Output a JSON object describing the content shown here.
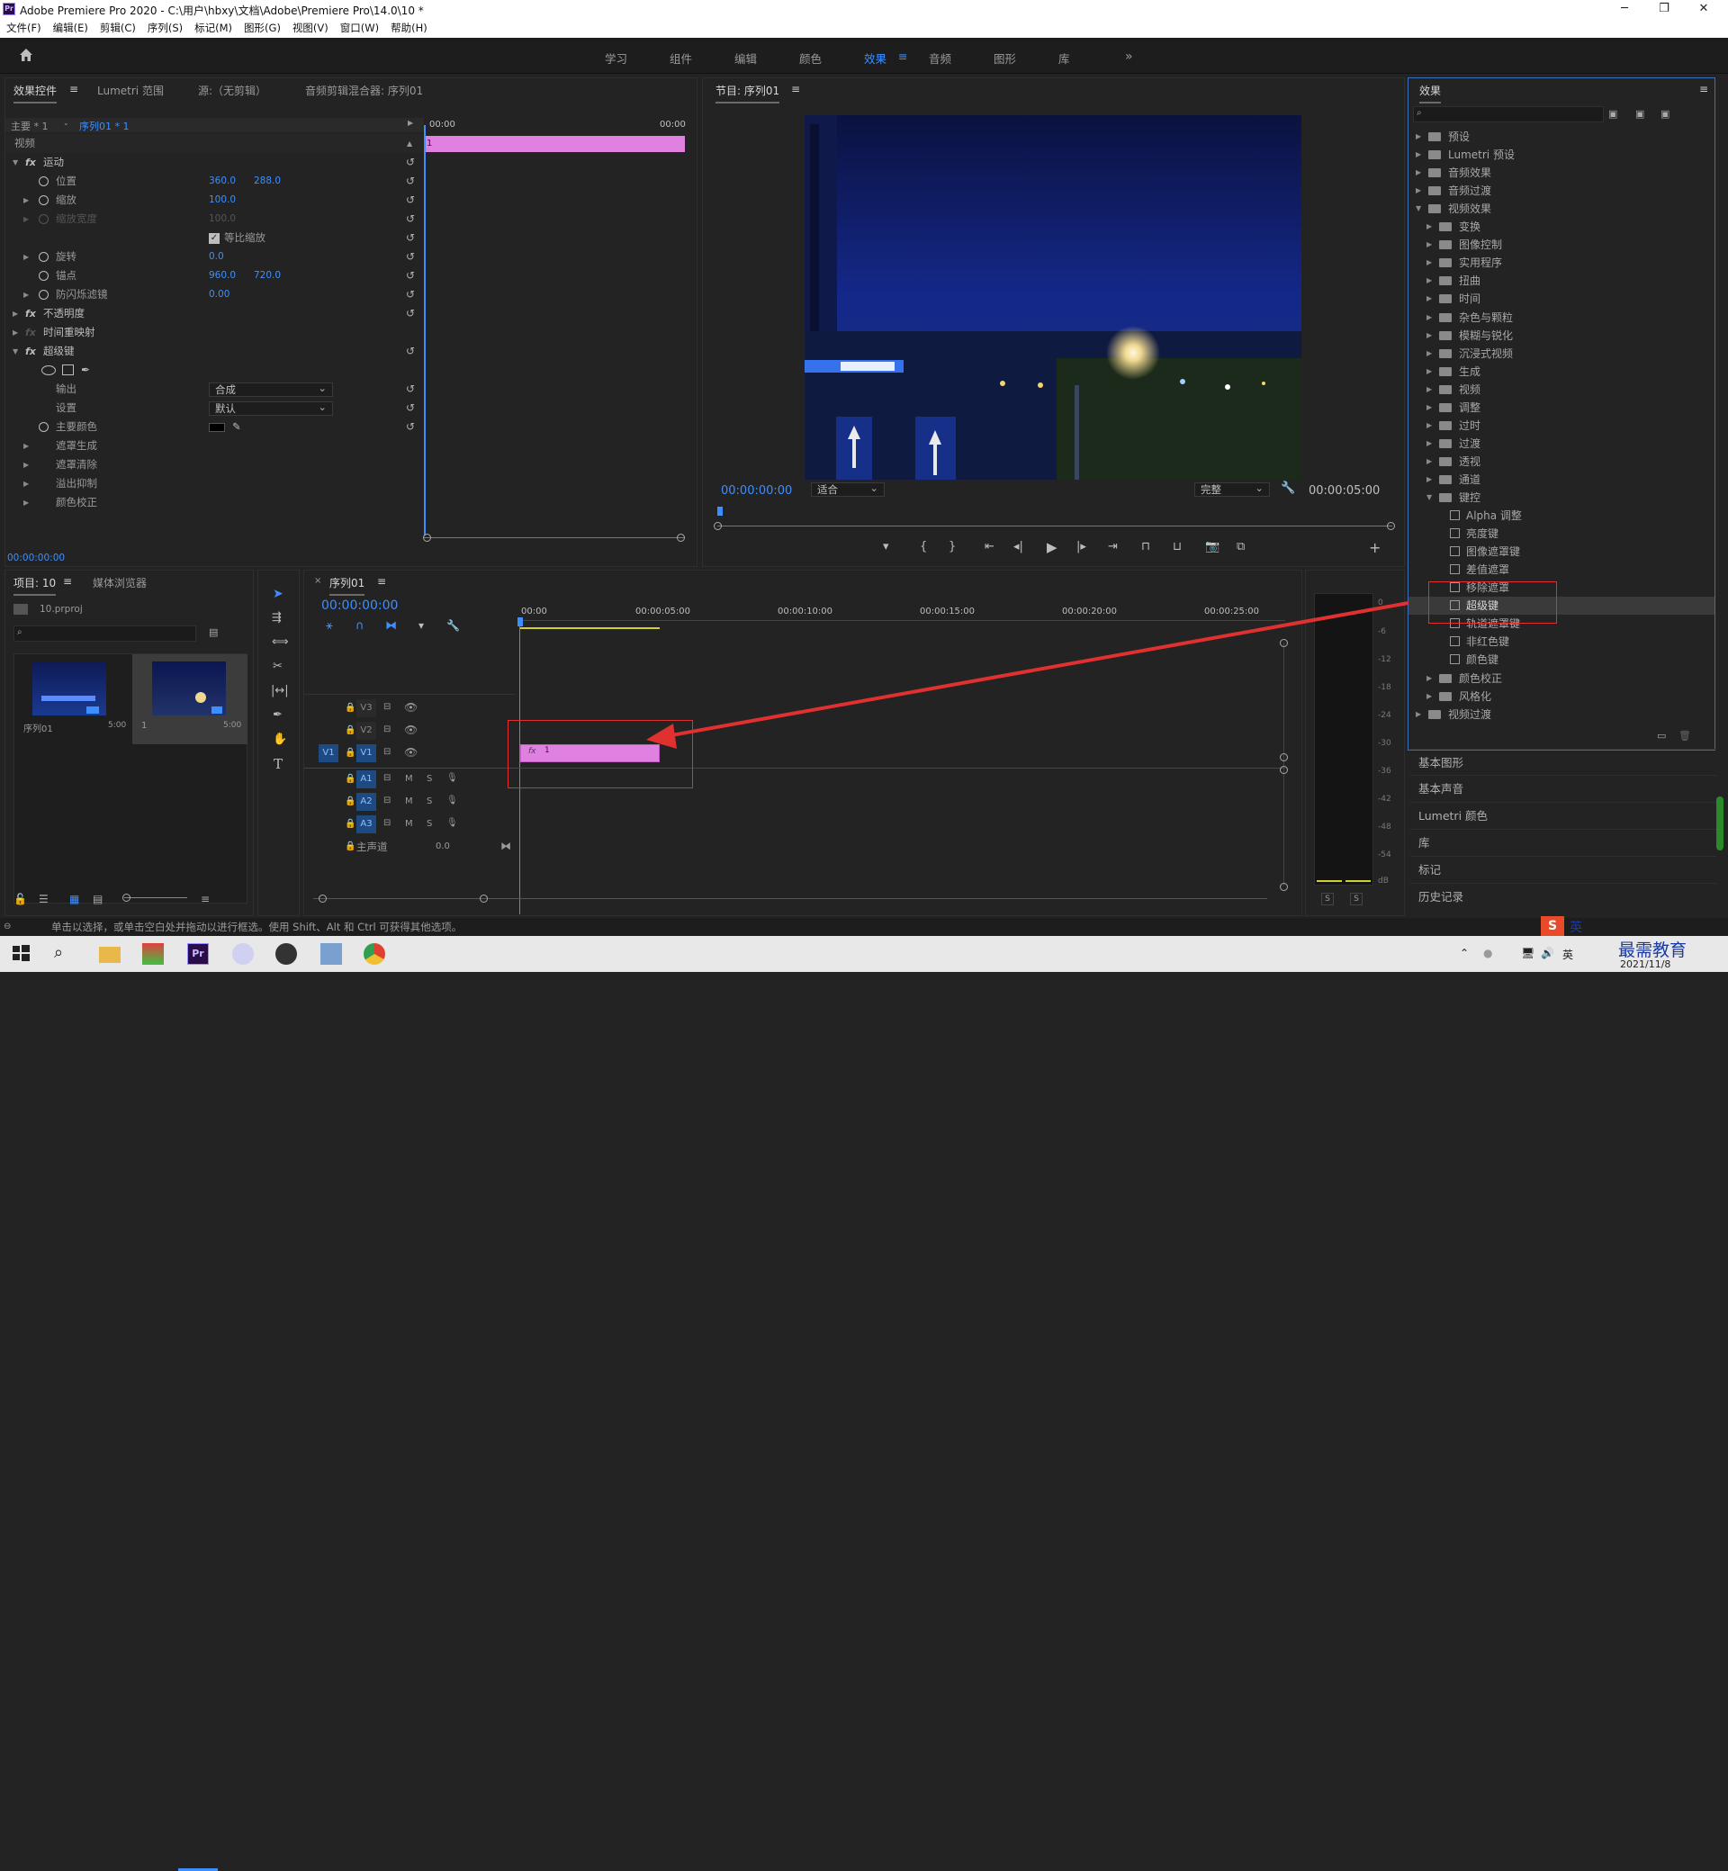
{
  "window": {
    "title": "Adobe Premiere Pro 2020 - C:\\用户\\hbxy\\文档\\Adobe\\Premiere Pro\\14.0\\10 *",
    "app_icon": "Pr"
  },
  "menu": [
    "文件(F)",
    "编辑(E)",
    "剪辑(C)",
    "序列(S)",
    "标记(M)",
    "图形(G)",
    "视图(V)",
    "窗口(W)",
    "帮助(H)"
  ],
  "workspaces": [
    {
      "label": "学习"
    },
    {
      "label": "组件"
    },
    {
      "label": "编辑"
    },
    {
      "label": "颜色"
    },
    {
      "label": "效果",
      "active": true
    },
    {
      "label": "音频"
    },
    {
      "label": "图形"
    },
    {
      "label": "库"
    }
  ],
  "effect_controls": {
    "tabs": [
      "效果控件",
      "Lumetri 范围",
      "源:（无剪辑）",
      "音频剪辑混合器: 序列01"
    ],
    "master": "主要 * 1",
    "sequence": "序列01 * 1",
    "timecode_start": "00:00",
    "timecode_end": "00:00",
    "clip_label": "1",
    "section_video": "视频",
    "motion": "运动",
    "position_label": "位置",
    "position_x": "360.0",
    "position_y": "288.0",
    "scale_label": "缩放",
    "scale_value": "100.0",
    "scale_width_label": "缩放宽度",
    "scale_width_value": "100.0",
    "uniform_scale_label": "等比缩放",
    "rotation_label": "旋转",
    "rotation_value": "0.0",
    "anchor_label": "锚点",
    "anchor_x": "960.0",
    "anchor_y": "720.0",
    "flicker_label": "防闪烁滤镜",
    "flicker_value": "0.00",
    "opacity": "不透明度",
    "time_remap": "时间重映射",
    "ultra_key": "超级键",
    "output_label": "输出",
    "output_value": "合成",
    "setting_label": "设置",
    "setting_value": "默认",
    "key_color_label": "主要颜色",
    "matte_gen": "遮罩生成",
    "matte_cleanup": "遮罩清除",
    "spill": "溢出抑制",
    "color_correction": "颜色校正",
    "footer_timecode": "00:00:00:00"
  },
  "program": {
    "title": "节目: 序列01",
    "timecode": "00:00:00:00",
    "fit": "适合",
    "quality": "完整",
    "duration": "00:00:05:00"
  },
  "effects_panel": {
    "title": "效果",
    "items": [
      {
        "label": "预设",
        "level": 0,
        "type": "folder"
      },
      {
        "label": "Lumetri 预设",
        "level": 0,
        "type": "folder"
      },
      {
        "label": "音频效果",
        "level": 0,
        "type": "folder"
      },
      {
        "label": "音频过渡",
        "level": 0,
        "type": "folder"
      },
      {
        "label": "视频效果",
        "level": 0,
        "type": "folder",
        "open": true
      },
      {
        "label": "变换",
        "level": 1,
        "type": "folder"
      },
      {
        "label": "图像控制",
        "level": 1,
        "type": "folder"
      },
      {
        "label": "实用程序",
        "level": 1,
        "type": "folder"
      },
      {
        "label": "扭曲",
        "level": 1,
        "type": "folder"
      },
      {
        "label": "时间",
        "level": 1,
        "type": "folder"
      },
      {
        "label": "杂色与颗粒",
        "level": 1,
        "type": "folder"
      },
      {
        "label": "模糊与锐化",
        "level": 1,
        "type": "folder"
      },
      {
        "label": "沉浸式视频",
        "level": 1,
        "type": "folder"
      },
      {
        "label": "生成",
        "level": 1,
        "type": "folder"
      },
      {
        "label": "视频",
        "level": 1,
        "type": "folder"
      },
      {
        "label": "调整",
        "level": 1,
        "type": "folder"
      },
      {
        "label": "过时",
        "level": 1,
        "type": "folder"
      },
      {
        "label": "过渡",
        "level": 1,
        "type": "folder"
      },
      {
        "label": "透视",
        "level": 1,
        "type": "folder"
      },
      {
        "label": "通道",
        "level": 1,
        "type": "folder"
      },
      {
        "label": "键控",
        "level": 1,
        "type": "folder",
        "open": true
      },
      {
        "label": "Alpha 调整",
        "level": 2,
        "type": "effect"
      },
      {
        "label": "亮度键",
        "level": 2,
        "type": "effect"
      },
      {
        "label": "图像遮罩键",
        "level": 2,
        "type": "effect"
      },
      {
        "label": "差值遮罩",
        "level": 2,
        "type": "effect"
      },
      {
        "label": "移除遮罩",
        "level": 2,
        "type": "effect"
      },
      {
        "label": "超级键",
        "level": 2,
        "type": "effect",
        "selected": true
      },
      {
        "label": "轨道遮罩键",
        "level": 2,
        "type": "effect"
      },
      {
        "label": "非红色键",
        "level": 2,
        "type": "effect"
      },
      {
        "label": "颜色键",
        "level": 2,
        "type": "effect"
      },
      {
        "label": "颜色校正",
        "level": 1,
        "type": "folder"
      },
      {
        "label": "风格化",
        "level": 1,
        "type": "folder"
      },
      {
        "label": "视频过渡",
        "level": 0,
        "type": "folder"
      }
    ]
  },
  "side_panels": [
    "基本图形",
    "基本声音",
    "Lumetri 颜色",
    "库",
    "标记",
    "历史记录"
  ],
  "project": {
    "tabs": [
      "项目: 10",
      "媒体浏览器"
    ],
    "file": "10.prproj",
    "thumbs": [
      {
        "name": "序列01",
        "dur": "5:00"
      },
      {
        "name": "1",
        "dur": "5:00"
      }
    ]
  },
  "timeline": {
    "tab": "序列01",
    "timecode": "00:00:00:00",
    "ruler": [
      "00:00",
      "00:00:05:00",
      "00:00:10:00",
      "00:00:15:00",
      "00:00:20:00",
      "00:00:25:00"
    ],
    "video_tracks": [
      "V3",
      "V2",
      "V1"
    ],
    "audio_tracks": [
      "A1",
      "A2",
      "A3"
    ],
    "master": "主声道",
    "master_value": "0.0",
    "clip_label": "1",
    "source_patch": "V1"
  },
  "meter_scale": [
    "0",
    "-6",
    "-12",
    "-18",
    "-24",
    "-30",
    "-36",
    "-42",
    "-48",
    "-54",
    "dB"
  ],
  "meter_solo": [
    "S",
    "S"
  ],
  "status": "单击以选择，或单击空白处并拖动以进行框选。使用 Shift、Alt 和 Ctrl 可获得其他选项。",
  "taskbar": {
    "ime": "英",
    "date": "2021/11/8",
    "watermark": "最需教育"
  },
  "colors": {
    "accent": "#3d8fff",
    "clip": "#e080e0",
    "highlight": "#e03030"
  }
}
